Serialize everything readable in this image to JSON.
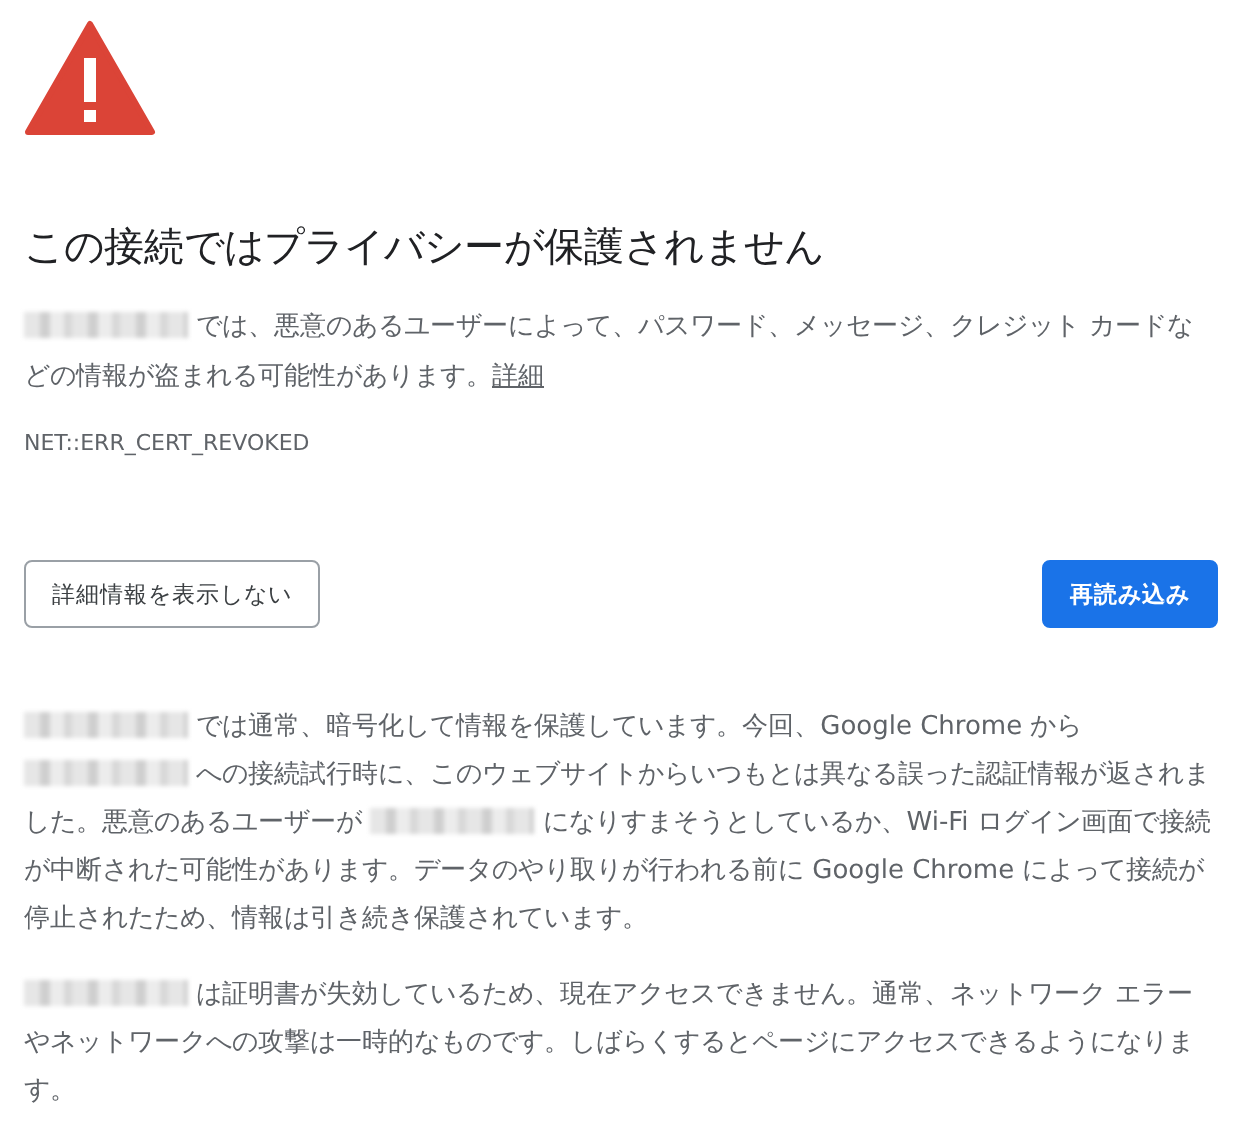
{
  "title": "この接続ではプライバシーが保護されません",
  "summary": [
    {
      "kind": "blur"
    },
    {
      "kind": "text",
      "text": " では、悪意のあるユーザーによって、パスワード、メッセージ、クレジット カードなどの情報が盗まれる可能性があります。"
    },
    {
      "kind": "link",
      "text": "詳細"
    }
  ],
  "error_code": "NET::ERR_CERT_REVOKED",
  "buttons": [
    {
      "label": "詳細情報を表示しない",
      "kind": "secondary"
    },
    {
      "label": "再読み込み",
      "kind": "primary"
    }
  ],
  "details": [
    [
      {
        "kind": "blur"
      },
      {
        "kind": "text",
        "text": " では通常、暗号化して情報を保護しています。今回、Google Chrome から "
      },
      {
        "kind": "blur"
      },
      {
        "kind": "text",
        "text": " への接続試行時に、このウェブサイトからいつもとは異なる誤った認証情報が返されました。悪意のあるユーザーが "
      },
      {
        "kind": "blur"
      },
      {
        "kind": "text",
        "text": " になりすまそうとしているか、Wi-Fi ログイン画面で接続が中断された可能性があります。データのやり取りが行われる前に Google Chrome によって接続が停止されたため、情報は引き続き保護されています。"
      }
    ],
    [
      {
        "kind": "blur"
      },
      {
        "kind": "text",
        "text": " は証明書が失効しているため、現在アクセスできません。通常、ネットワーク エラーやネットワークへの攻撃は一時的なものです。しばらくするとページにアクセスできるようになります。"
      }
    ]
  ]
}
